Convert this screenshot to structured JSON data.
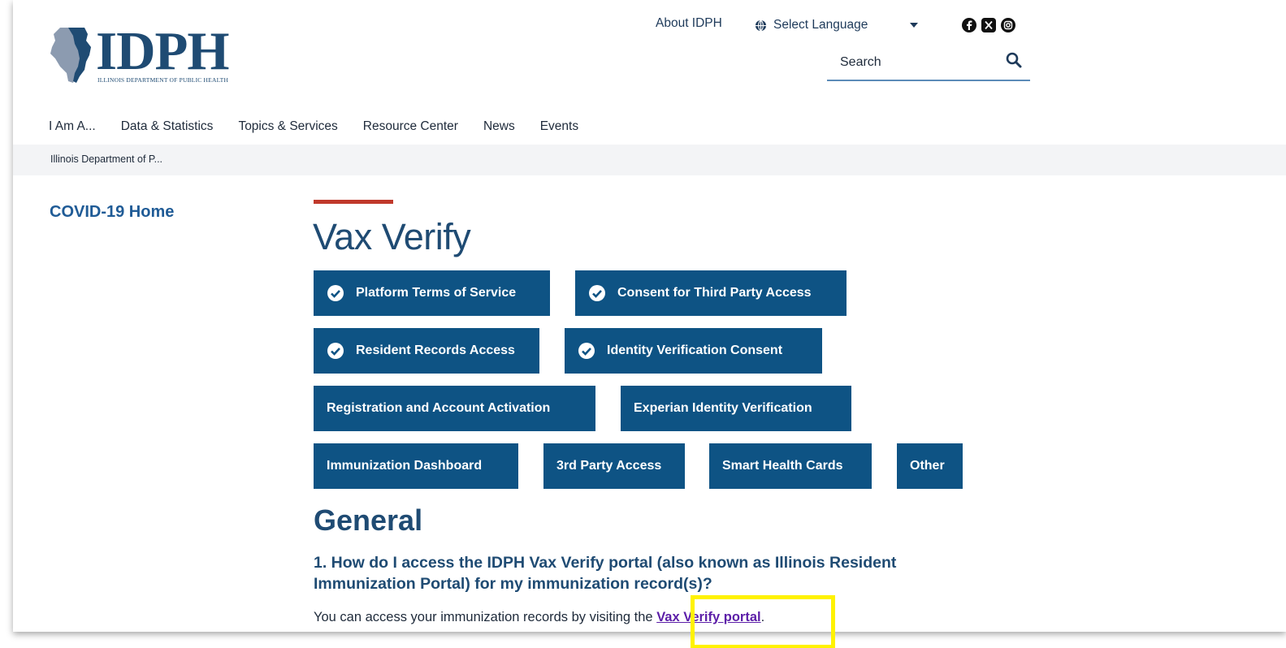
{
  "header": {
    "logo_text": "IDPH",
    "logo_subtitle": "ILLINOIS DEPARTMENT OF PUBLIC HEALTH",
    "about_link": "About IDPH",
    "language_select": "Select Language",
    "search_label": "Search",
    "social_icons": [
      "facebook-icon",
      "x-icon",
      "instagram-icon"
    ]
  },
  "nav": {
    "items": [
      "I Am A...",
      "Data & Statistics",
      "Topics & Services",
      "Resource Center",
      "News",
      "Events"
    ]
  },
  "breadcrumb": "Illinois Department of P...",
  "sidebar": {
    "link": "COVID-19 Home"
  },
  "main": {
    "title": "Vax Verify",
    "buttons": [
      {
        "label": "Platform Terms of Service",
        "checked": true
      },
      {
        "label": "Consent for Third Party Access",
        "checked": true
      },
      {
        "label": "Resident Records Access",
        "checked": true
      },
      {
        "label": "Identity Verification Consent",
        "checked": true
      },
      {
        "label": "Registration and Account Activation",
        "checked": false
      },
      {
        "label": "Experian Identity Verification",
        "checked": false
      },
      {
        "label": "Immunization Dashboard",
        "checked": false
      },
      {
        "label": "3rd Party Access",
        "checked": false
      },
      {
        "label": "Smart Health Cards",
        "checked": false
      },
      {
        "label": "Other",
        "checked": false
      }
    ],
    "section_title": "General",
    "question": "1. How do I access the IDPH Vax Verify portal (also known as Illinois Resident Immunization Portal) for my immunization record(s)?",
    "answer_prefix": "You can access your immunization records by visiting the ",
    "answer_link": "Vax Verify portal",
    "answer_suffix": "."
  },
  "colors": {
    "brand_blue": "#1f4b73",
    "button_blue": "#0e5384",
    "accent_red": "#c0392b",
    "link_purple": "#5c1ea8",
    "highlight_yellow": "#fff200"
  }
}
